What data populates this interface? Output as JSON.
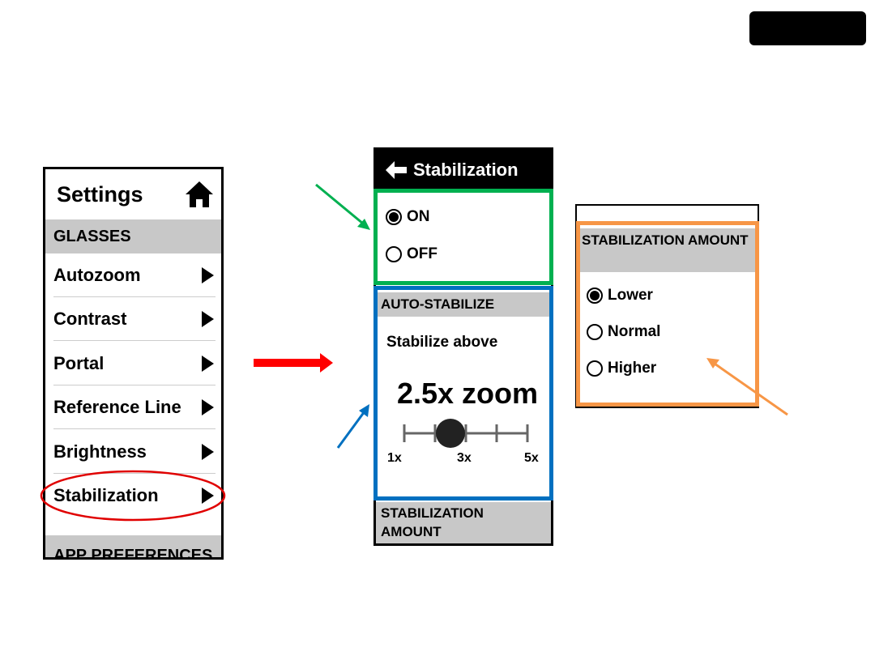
{
  "settings_panel": {
    "title": "Settings",
    "home_icon": "home-icon",
    "section_glasses": "GLASSES",
    "items": [
      {
        "label": "Autozoom"
      },
      {
        "label": "Contrast"
      },
      {
        "label": "Portal"
      },
      {
        "label": "Reference Line"
      },
      {
        "label": "Brightness"
      },
      {
        "label": "Stabilization"
      }
    ],
    "section_app": "APP PREFERENCES"
  },
  "stabilization_panel": {
    "title": "Stabilization",
    "back_icon": "arrow-left-icon",
    "options": [
      {
        "label": "ON",
        "selected": true
      },
      {
        "label": "OFF",
        "selected": false
      }
    ],
    "auto_section": "AUTO-STABILIZE",
    "stabilize_above": "Stabilize above",
    "zoom_value": "2.5x zoom",
    "slider": {
      "min": 1,
      "max": 5,
      "value": 2.5,
      "labels": [
        "1x",
        "3x",
        "5x"
      ]
    },
    "amount_section": "STABILIZATION AMOUNT"
  },
  "amount_panel": {
    "section": "STABILIZATION AMOUNT",
    "options": [
      {
        "label": "Lower",
        "selected": true
      },
      {
        "label": "Normal",
        "selected": false
      },
      {
        "label": "Higher",
        "selected": false
      }
    ]
  },
  "colors": {
    "green": "#00b050",
    "blue": "#0070c0",
    "orange": "#f79646",
    "red": "#ff0000"
  }
}
